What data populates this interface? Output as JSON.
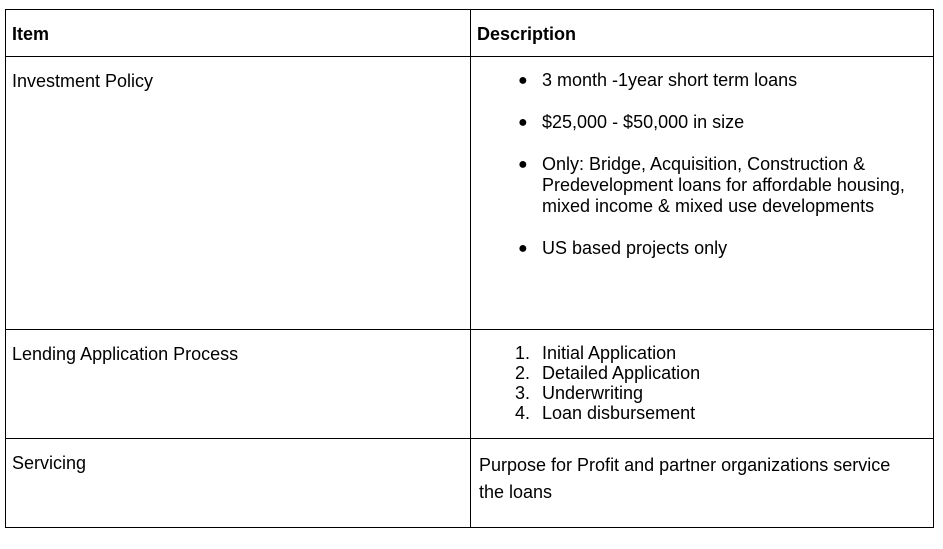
{
  "table": {
    "headers": {
      "item": "Item",
      "description": "Description"
    },
    "rows": [
      {
        "item": "Investment Policy",
        "bullets": [
          "3 month -1year short term loans",
          "$25,000 - $50,000 in size",
          "Only: Bridge, Acquisition, Construction & Predevelopment loans for affordable housing, mixed income & mixed use developments",
          "US based projects only"
        ]
      },
      {
        "item": "Lending Application Process",
        "steps": [
          {
            "num": "1.",
            "text": "Initial Application"
          },
          {
            "num": "2.",
            "text": "Detailed Application"
          },
          {
            "num": "3.",
            "text": "Underwriting"
          },
          {
            "num": "4.",
            "text": "Loan disbursement"
          }
        ]
      },
      {
        "item": "Servicing",
        "text": "Purpose for Profit and partner organizations service the loans"
      }
    ]
  },
  "bullet_glyph": "●"
}
